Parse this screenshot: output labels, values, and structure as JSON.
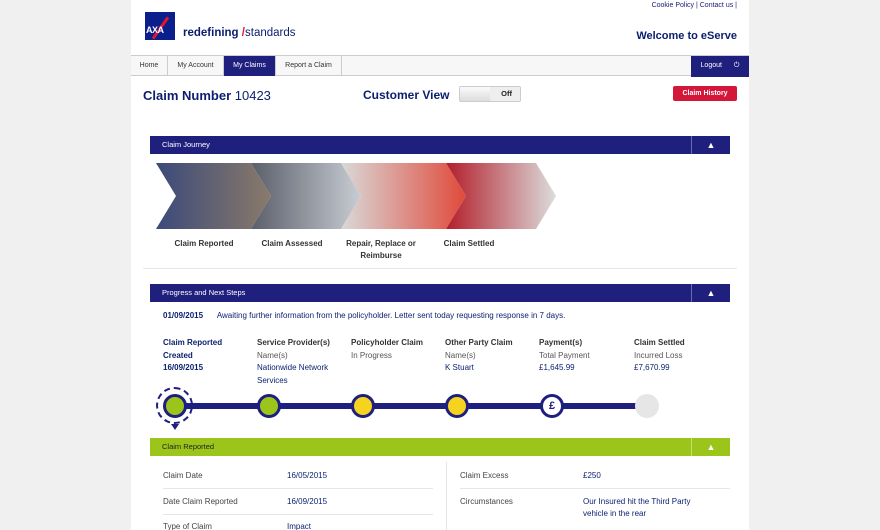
{
  "header": {
    "cookie_policy": "Cookie Policy",
    "contact_us": "Contact us",
    "sep": "|",
    "logo_text": "AXA",
    "tagline_bold": "redefining",
    "tagline_slash": "/",
    "tagline_rest": "standards",
    "welcome": "Welcome to eServe"
  },
  "nav": {
    "tabs": [
      {
        "label": "Home"
      },
      {
        "label": "My Account"
      },
      {
        "label": "My Claims"
      },
      {
        "label": "Report a Claim"
      }
    ],
    "active": "My Claims",
    "logout": "Logout",
    "logout_icon": "power-icon"
  },
  "claim": {
    "title_label": "Claim Number",
    "number": "10423",
    "customer_view_label": "Customer View",
    "customer_view_value": "Off",
    "history_button": "Claim History"
  },
  "journey": {
    "title": "Claim Journey",
    "stages": [
      "Claim Reported",
      "Claim Assessed",
      "Repair, Replace or Reimburse",
      "Claim Settled"
    ]
  },
  "progress": {
    "title": "Progress and Next Steps",
    "date": "01/09/2015",
    "message": "Awaiting further information from the policyholder. Letter sent today requesting response in 7 days.",
    "steps": [
      {
        "heading": "Claim Reported",
        "line1": "Created",
        "line2": "16/09/2015",
        "line3": ""
      },
      {
        "heading": "Service Provider(s)",
        "line1": "Name(s)",
        "line2": "Nationwide Network",
        "line3": "Services"
      },
      {
        "heading": "Policyholder Claim",
        "line1": "In Progress",
        "line2": "",
        "line3": ""
      },
      {
        "heading": "Other Party Claim",
        "line1": "Name(s)",
        "line2": "K Stuart",
        "line3": ""
      },
      {
        "heading": "Payment(s)",
        "line1": "Total Payment",
        "line2": "£1,645.99",
        "line3": ""
      },
      {
        "heading": "Claim Settled",
        "line1": "Incurred Loss",
        "line2": "£7,670.99",
        "line3": ""
      }
    ],
    "pound_symbol": "£",
    "colors": {
      "done": "#9cc51c",
      "in_progress": "#f5d31f",
      "pending": "#e6e6e6",
      "track": "#1f1f7e"
    }
  },
  "details": {
    "title": "Claim Reported",
    "left": [
      {
        "label": "Claim Date",
        "value": "16/05/2015"
      },
      {
        "label": "Date Claim Reported",
        "value": "16/09/2015"
      },
      {
        "label": "Type of Claim",
        "value": "Impact"
      }
    ],
    "right": [
      {
        "label": "Claim Excess",
        "value": "£250"
      },
      {
        "label": "Circumstances",
        "value": "Our Insured hit the Third Party",
        "value2": "vehicle in the rear"
      }
    ]
  },
  "collapse_icon": "chevron-up-icon"
}
